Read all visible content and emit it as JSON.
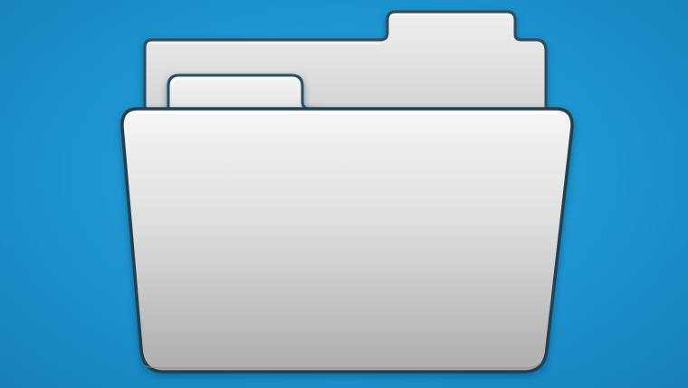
{
  "background": {
    "color": "#1e97d2"
  },
  "folder": {
    "icon": "folder-icon",
    "color_light": "#f7f7f7",
    "color_dark": "#a9a9a9",
    "outline_color": "#264a5c"
  }
}
